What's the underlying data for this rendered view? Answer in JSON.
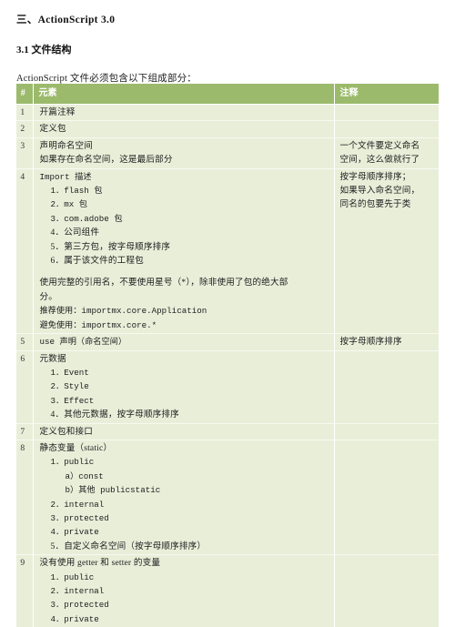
{
  "document": {
    "heading": "三、ActionScript 3.0",
    "subheading": "3.1 文件结构",
    "paragraph": "ActionScript 文件必须包含以下组成部分："
  },
  "table": {
    "headers": {
      "num": "#",
      "element": "元素",
      "note": "注释"
    },
    "rows": [
      {
        "num": "1",
        "lines": [
          {
            "text": "开篇注释",
            "style": "plain",
            "indent": 0
          }
        ],
        "note": []
      },
      {
        "num": "2",
        "lines": [
          {
            "text": "定义包",
            "style": "plain",
            "indent": 0
          }
        ],
        "note": []
      },
      {
        "num": "3",
        "lines": [
          {
            "text": "声明命名空间",
            "style": "plain",
            "indent": 0
          },
          {
            "text": "如果存在命名空间，这是最后部分",
            "style": "plain",
            "indent": 0
          }
        ],
        "note": [
          "一个文件要定义命名",
          "空间，这么做就行了"
        ]
      },
      {
        "num": "4",
        "lines": [
          {
            "text": "Import 描述",
            "style": "mono",
            "indent": 0
          },
          {
            "text": "1．flash 包",
            "style": "mono",
            "indent": 1
          },
          {
            "text": "2．mx 包",
            "style": "mono",
            "indent": 1
          },
          {
            "text": "3．com.adobe 包",
            "style": "mono",
            "indent": 1
          },
          {
            "text": "4．公司组件",
            "style": "plain",
            "indent": 1
          },
          {
            "text": "5．第三方包，按字母顺序排序",
            "style": "plain",
            "indent": 1
          },
          {
            "text": "6．属于该文件的工程包",
            "style": "plain",
            "indent": 1
          },
          {
            "text": "",
            "style": "spacer",
            "indent": 0
          },
          {
            "text": "使用完整的引用名，不要使用星号（*），除非使用了包的绝大部",
            "style": "plain",
            "indent": 0
          },
          {
            "text": "分。",
            "style": "plain",
            "indent": 0
          },
          {
            "text": "推荐使用：importmx.core.Application",
            "style": "mono",
            "indent": 0
          },
          {
            "text": "避免使用：importmx.core.*",
            "style": "mono",
            "indent": 0
          }
        ],
        "note": [
          "按字母顺序排序；",
          "如果导入命名空间，",
          "同名的包要先于类"
        ]
      },
      {
        "num": "5",
        "lines": [
          {
            "text": "use 声明（命名空间）",
            "style": "mono",
            "indent": 0
          }
        ],
        "note": [
          "按字母顺序排序"
        ]
      },
      {
        "num": "6",
        "lines": [
          {
            "text": "元数据",
            "style": "plain",
            "indent": 0
          },
          {
            "text": "1．Event",
            "style": "mono",
            "indent": 1
          },
          {
            "text": "2．Style",
            "style": "mono",
            "indent": 1
          },
          {
            "text": "3．Effect",
            "style": "mono",
            "indent": 1
          },
          {
            "text": "4．其他元数据，按字母顺序排序",
            "style": "plain",
            "indent": 1
          }
        ],
        "note": []
      },
      {
        "num": "7",
        "lines": [
          {
            "text": "定义包和接口",
            "style": "plain",
            "indent": 0
          }
        ],
        "note": []
      },
      {
        "num": "8",
        "lines": [
          {
            "text": "静态变量（static）",
            "style": "plain",
            "indent": 0
          },
          {
            "text": "1．public",
            "style": "mono",
            "indent": 1
          },
          {
            "text": "a）const",
            "style": "mono",
            "indent": 2
          },
          {
            "text": "b）其他 publicstatic",
            "style": "mono",
            "indent": 2
          },
          {
            "text": "2．internal",
            "style": "mono",
            "indent": 1
          },
          {
            "text": "3．protected",
            "style": "mono",
            "indent": 1
          },
          {
            "text": "4．private",
            "style": "mono",
            "indent": 1
          },
          {
            "text": "5．自定义命名空间（按字母顺序排序）",
            "style": "plain",
            "indent": 1
          }
        ],
        "note": []
      },
      {
        "num": "9",
        "lines": [
          {
            "text": "没有使用 getter 和 setter 的变量",
            "style": "plain",
            "indent": 0
          },
          {
            "text": "1．public",
            "style": "mono",
            "indent": 1
          },
          {
            "text": "2．internal",
            "style": "mono",
            "indent": 1
          },
          {
            "text": "3．protected",
            "style": "mono",
            "indent": 1
          },
          {
            "text": "4．private",
            "style": "mono",
            "indent": 1
          }
        ],
        "note": []
      }
    ]
  },
  "colors": {
    "header_background": "#9cba6c",
    "header_text": "#ffffff",
    "row_background": "#e9eed9",
    "row_divider": "#ffffff",
    "body_text": "#1d1d1d",
    "page_background": "#ffffff"
  }
}
